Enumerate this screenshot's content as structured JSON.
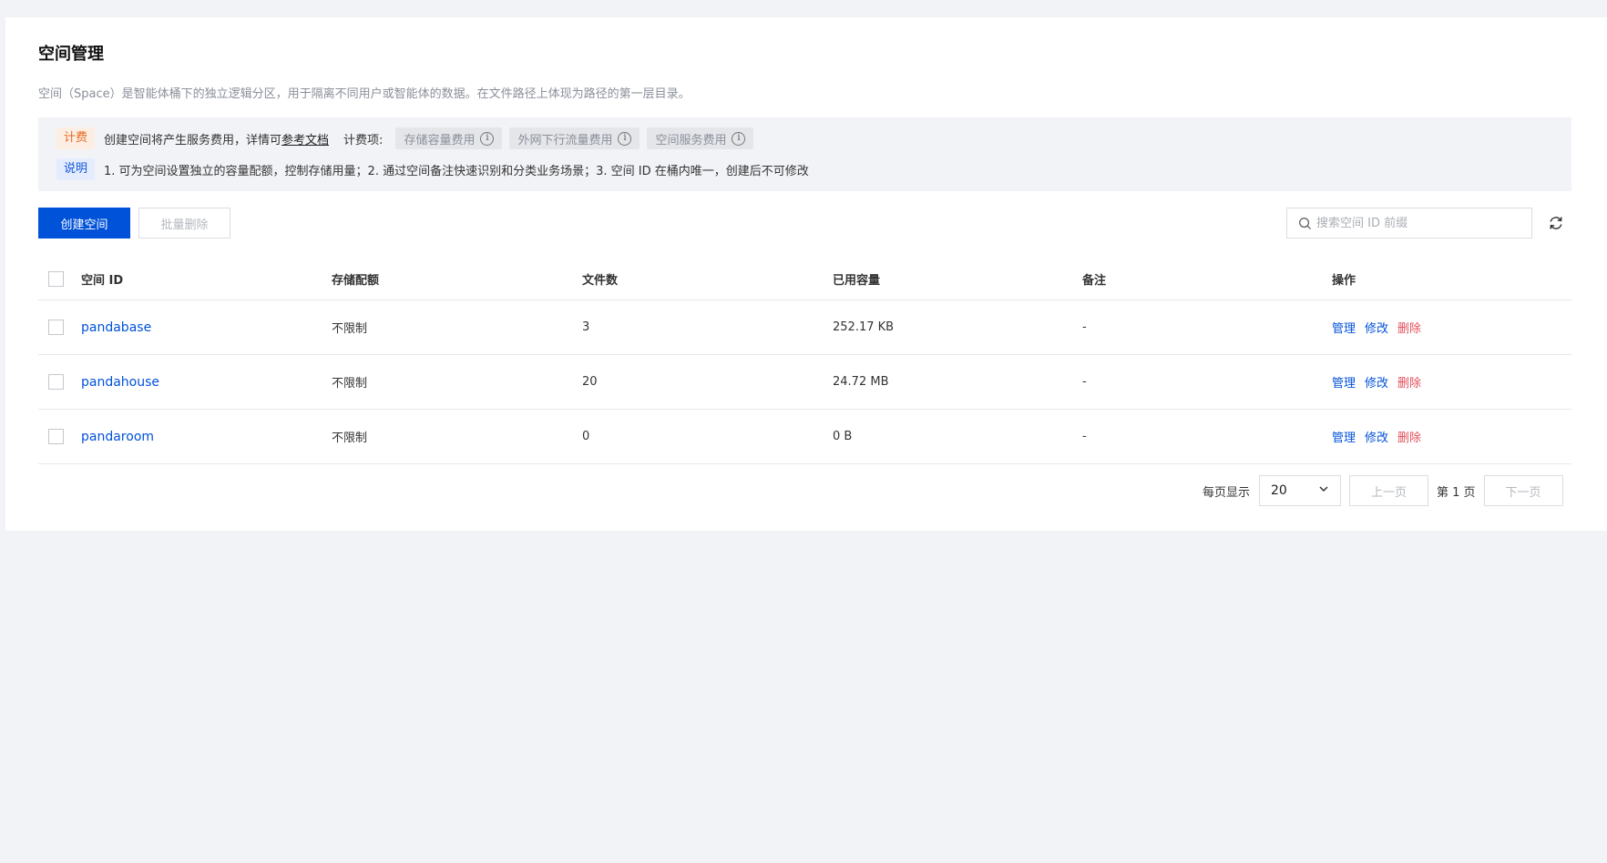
{
  "page": {
    "title": "空间管理",
    "description": "空间（Space）是智能体桶下的独立逻辑分区，用于隔离不同用户或智能体的数据。在文件路径上体现为路径的第一层目录。"
  },
  "notice": {
    "fee_tag": "计费",
    "fee_text": "创建空间将产生服务费用，详情可",
    "fee_link": "参考文档",
    "fee_items_label": "计费项:",
    "fee_items": [
      "存储容量费用",
      "外网下行流量费用",
      "空间服务费用"
    ],
    "note_tag": "说明",
    "note_text": "1. 可为空间设置独立的容量配额，控制存储用量；2. 通过空间备注快速识别和分类业务场景；3. 空间 ID 在桶内唯一，创建后不可修改"
  },
  "toolbar": {
    "create_label": "创建空间",
    "batch_delete_label": "批量删除",
    "search_placeholder": "搜索空间 ID 前缀"
  },
  "table": {
    "columns": {
      "id": "空间 ID",
      "quota": "存储配额",
      "files": "文件数",
      "used": "已用容量",
      "remark": "备注",
      "ops": "操作"
    },
    "rows": [
      {
        "id": "pandabase",
        "quota": "不限制",
        "files": "3",
        "used": "252.17 KB",
        "remark": "-",
        "manage": "管理",
        "edit": "修改",
        "delete": "删除"
      },
      {
        "id": "pandahouse",
        "quota": "不限制",
        "files": "20",
        "used": "24.72 MB",
        "remark": "-",
        "manage": "管理",
        "edit": "修改",
        "delete": "删除"
      },
      {
        "id": "pandaroom",
        "quota": "不限制",
        "files": "0",
        "used": "0 B",
        "remark": "-",
        "manage": "管理",
        "edit": "修改",
        "delete": "删除"
      }
    ]
  },
  "pagination": {
    "per_page_label": "每页显示",
    "per_page_value": "20",
    "prev_label": "上一页",
    "page_label": "第 1 页",
    "next_label": "下一页"
  },
  "colors": {
    "primary": "#0052d9",
    "danger": "#e34d59",
    "fee_tag": "#e86a1f",
    "background": "#f2f3f7"
  }
}
